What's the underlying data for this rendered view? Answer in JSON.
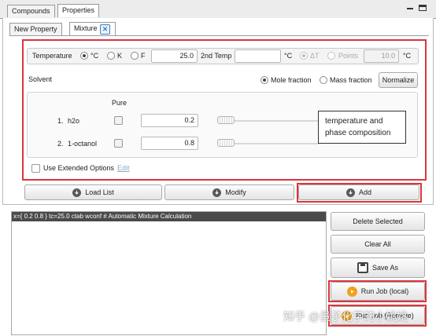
{
  "tabs": {
    "compounds": "Compounds",
    "properties": "Properties"
  },
  "window_controls": {
    "minimize": "−",
    "maximize": "□"
  },
  "subtabs": {
    "new_property": "New Property",
    "mixture": "Mixture",
    "mixture_close": "✕"
  },
  "temperature": {
    "label": "Temperature",
    "unit_c": "°C",
    "unit_k": "K",
    "unit_f": "F",
    "selected_unit": "°C",
    "value": "25.0",
    "second_label": "2nd Temp",
    "second_value": "",
    "second_unit": "°C",
    "delta_label": "ΔT",
    "points_label": "Points",
    "points_value": "10.0",
    "end_unit": "°C"
  },
  "solvent": {
    "label": "Solvent",
    "mole_fraction": "Mole fraction",
    "mass_fraction": "Mass fraction",
    "selected": "Mole fraction",
    "normalize": "Normalize"
  },
  "components": {
    "pure_header": "Pure",
    "rows": [
      {
        "index": "1.",
        "name": "h2o",
        "pure": false,
        "value": "0.2"
      },
      {
        "index": "2.",
        "name": "1-octanol",
        "pure": false,
        "value": "0.8"
      }
    ]
  },
  "callout": {
    "line1": "temperature and",
    "line2": "phase composition"
  },
  "extended": {
    "label": "Use Extended Options",
    "edit": "Edit"
  },
  "actions": {
    "load_list": "Load List",
    "modify": "Modify",
    "add": "Add"
  },
  "job_list": {
    "entry": "x={ 0.2 0.8 }  tc=25.0 ctab wconf # Automatic Mixture Calculation"
  },
  "side_buttons": {
    "delete_selected": "Delete Selected",
    "clear_all": "Clear All",
    "save_as": "Save As",
    "run_local": "Run Job (local)",
    "run_remote": "Run Job (Remote)"
  },
  "watermark": "知乎 @量子化学的小姚姚",
  "colors": {
    "highlight": "#d9363e",
    "run_icon": "#f0a11b"
  }
}
